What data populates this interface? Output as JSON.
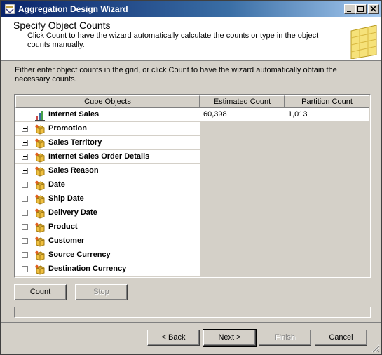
{
  "window": {
    "title": "Aggregation Design Wizard"
  },
  "header": {
    "title": "Specify Object Counts",
    "description": "Click Count to have the wizard automatically calculate the counts or type in the object counts manually."
  },
  "instruction": "Either enter object counts in the grid, or click Count to have the wizard automatically obtain the necessary counts.",
  "grid": {
    "columns": [
      "Cube Objects",
      "Estimated Count",
      "Partition Count"
    ],
    "measure_group": {
      "name": "Internet Sales",
      "estimated": "60,398",
      "partition": "1,013"
    },
    "dimensions": [
      "Promotion",
      "Sales Territory",
      "Internet Sales Order Details",
      "Sales Reason",
      "Date",
      "Ship Date",
      "Delivery Date",
      "Product",
      "Customer",
      "Source Currency",
      "Destination Currency"
    ]
  },
  "buttons": {
    "count": "Count",
    "stop": "Stop",
    "back": "< Back",
    "next": "Next >",
    "finish": "Finish",
    "cancel": "Cancel"
  }
}
